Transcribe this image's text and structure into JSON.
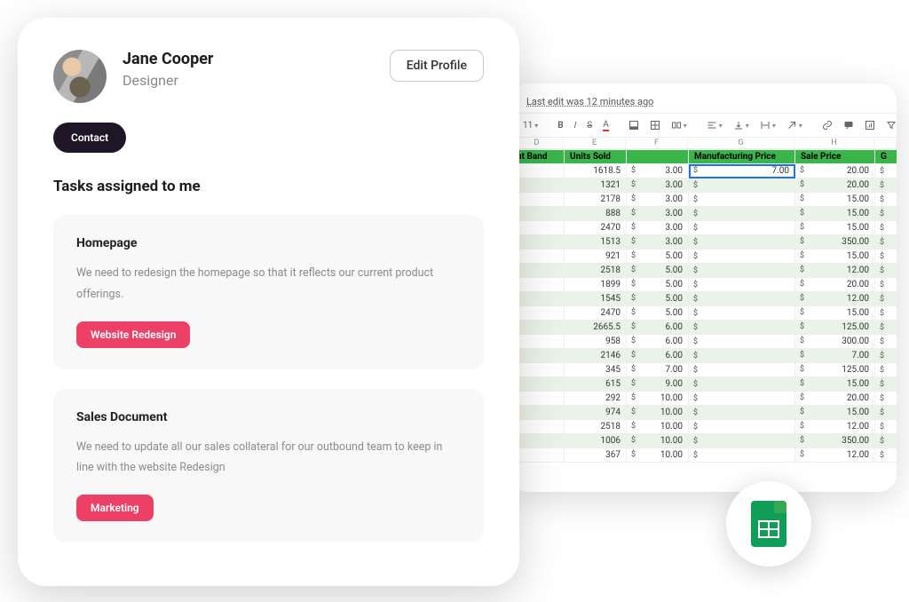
{
  "profile": {
    "name": "Jane Cooper",
    "role": "Designer",
    "edit_label": "Edit Profile",
    "contact_label": "Contact"
  },
  "tasks_heading": "Tasks assigned to me",
  "tasks": [
    {
      "title": "Homepage",
      "desc": "We need to redesign the homepage so that it reflects our current product offerings.",
      "tag": "Website Redesign"
    },
    {
      "title": "Sales Document",
      "desc": "We need to update all our sales collateral for our outbound team to keep in line with the website Redesign",
      "tag": "Marketing"
    }
  ],
  "sheet": {
    "status": "Last edit was 12 minutes ago",
    "font_size": "11",
    "col_letters": [
      "D",
      "E",
      "F",
      "G",
      "H",
      ""
    ],
    "headers": [
      "nt Band",
      "Units Sold",
      "",
      "Manufacturing Price",
      "Sale Price",
      "G"
    ],
    "selected": {
      "row": 0,
      "col": 3
    },
    "rows": [
      {
        "units": "1618.5",
        "blank": "",
        "mfg": "3.00",
        "mfg_sel": "7.00",
        "sale": "20.00"
      },
      {
        "units": "1321",
        "blank": "",
        "mfg": "3.00",
        "sale": "20.00"
      },
      {
        "units": "2178",
        "blank": "",
        "mfg": "3.00",
        "sale": "15.00"
      },
      {
        "units": "888",
        "blank": "",
        "mfg": "3.00",
        "sale": "15.00"
      },
      {
        "units": "2470",
        "blank": "",
        "mfg": "3.00",
        "sale": "15.00"
      },
      {
        "units": "1513",
        "blank": "",
        "mfg": "3.00",
        "sale": "350.00"
      },
      {
        "units": "921",
        "blank": "",
        "mfg": "5.00",
        "sale": "15.00"
      },
      {
        "units": "2518",
        "blank": "",
        "mfg": "5.00",
        "sale": "12.00"
      },
      {
        "units": "1899",
        "blank": "",
        "mfg": "5.00",
        "sale": "20.00"
      },
      {
        "units": "1545",
        "blank": "",
        "mfg": "5.00",
        "sale": "12.00"
      },
      {
        "units": "2470",
        "blank": "",
        "mfg": "5.00",
        "sale": "15.00"
      },
      {
        "units": "2665.5",
        "blank": "",
        "mfg": "6.00",
        "sale": "125.00"
      },
      {
        "units": "958",
        "blank": "",
        "mfg": "6.00",
        "sale": "300.00"
      },
      {
        "units": "2146",
        "blank": "",
        "mfg": "6.00",
        "sale": "7.00"
      },
      {
        "units": "345",
        "blank": "",
        "mfg": "7.00",
        "sale": "125.00"
      },
      {
        "units": "615",
        "blank": "",
        "mfg": "9.00",
        "sale": "15.00"
      },
      {
        "units": "292",
        "blank": "",
        "mfg": "10.00",
        "sale": "20.00"
      },
      {
        "units": "974",
        "blank": "",
        "mfg": "10.00",
        "sale": "15.00"
      },
      {
        "units": "2518",
        "blank": "",
        "mfg": "10.00",
        "sale": "12.00"
      },
      {
        "units": "1006",
        "blank": "",
        "mfg": "10.00",
        "sale": "350.00"
      },
      {
        "units": "367",
        "blank": "",
        "mfg": "10.00",
        "sale": "12.00"
      }
    ]
  }
}
